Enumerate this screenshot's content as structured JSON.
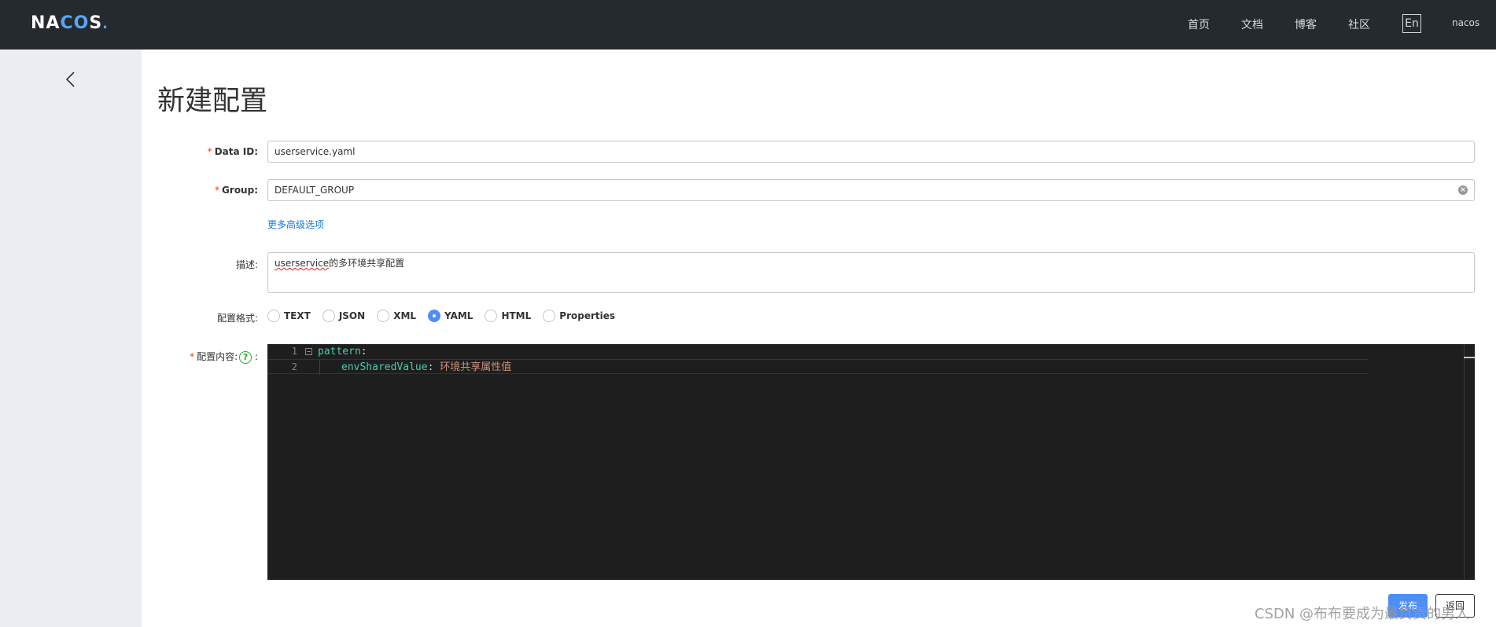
{
  "header": {
    "logo": "NACOS.",
    "nav": [
      "首页",
      "文档",
      "博客",
      "社区"
    ],
    "lang": "En",
    "user": "nacos"
  },
  "page": {
    "title": "新建配置"
  },
  "form": {
    "data_id_label": "Data ID:",
    "data_id_value": "userservice.yaml",
    "group_label": "Group:",
    "group_value": "DEFAULT_GROUP",
    "advanced_link": "更多高级选项",
    "desc_label": "描述:",
    "desc_value_spellflag": "userservice",
    "desc_value_rest": "的多环境共享配置",
    "format_label": "配置格式:",
    "formats": [
      "TEXT",
      "JSON",
      "XML",
      "YAML",
      "HTML",
      "Properties"
    ],
    "selected_format": "YAML",
    "content_label": "配置内容:",
    "content_suffix": ":"
  },
  "editor": {
    "lines": [
      {
        "num": "1",
        "key": "pattern",
        "sep": ":",
        "value": ""
      },
      {
        "num": "2",
        "key": "envSharedValue",
        "sep": ": ",
        "value": "环境共享属性值"
      }
    ]
  },
  "actions": {
    "publish": "发布",
    "back": "返回"
  },
  "watermark": "CSDN @布布要成为最负责的男人",
  "colors": {
    "topbar": "#252a2f",
    "sidebar": "#eaedf1",
    "primary": "#4e8ef7",
    "link": "#1a7ae0",
    "required": "#ff3000",
    "editor_bg": "#1e1e1e"
  }
}
